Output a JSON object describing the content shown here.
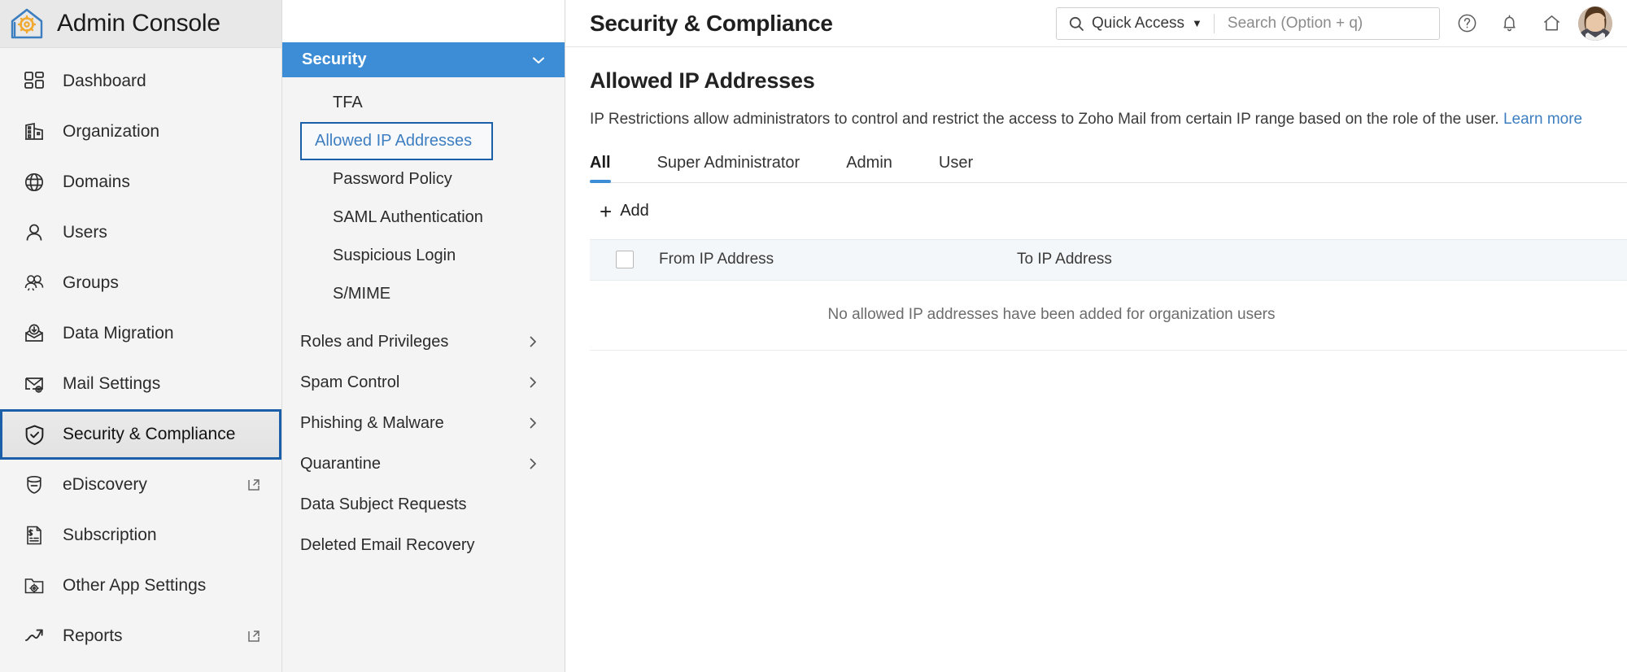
{
  "brand": {
    "title": "Admin Console",
    "logo_icon": "house-gear-logo"
  },
  "sidebar": {
    "items": [
      {
        "label": "Dashboard",
        "icon": "dashboard-grid-icon",
        "selected": false,
        "external": false
      },
      {
        "label": "Organization",
        "icon": "building-icon",
        "selected": false,
        "external": false
      },
      {
        "label": "Domains",
        "icon": "globe-icon",
        "selected": false,
        "external": false
      },
      {
        "label": "Users",
        "icon": "user-icon",
        "selected": false,
        "external": false
      },
      {
        "label": "Groups",
        "icon": "users-group-icon",
        "selected": false,
        "external": false
      },
      {
        "label": "Data Migration",
        "icon": "envelope-download-icon",
        "selected": false,
        "external": false
      },
      {
        "label": "Mail Settings",
        "icon": "envelope-gear-icon",
        "selected": false,
        "external": false
      },
      {
        "label": "Security & Compliance",
        "icon": "shield-check-icon",
        "selected": true,
        "external": false
      },
      {
        "label": "eDiscovery",
        "icon": "shield-search-icon",
        "selected": false,
        "external": true
      },
      {
        "label": "Subscription",
        "icon": "invoice-icon",
        "selected": false,
        "external": false
      },
      {
        "label": "Other App Settings",
        "icon": "folder-gear-icon",
        "selected": false,
        "external": false
      },
      {
        "label": "Reports",
        "icon": "trend-arrow-icon",
        "selected": false,
        "external": true
      }
    ]
  },
  "subpanel": {
    "header": {
      "title": "Security",
      "chevron_icon": "chevron-down-icon"
    },
    "items": [
      {
        "label": "TFA",
        "active": false
      },
      {
        "label": "Allowed IP Addresses",
        "active": true
      },
      {
        "label": "Password Policy",
        "active": false
      },
      {
        "label": "SAML Authentication",
        "active": false
      },
      {
        "label": "Suspicious Login",
        "active": false
      },
      {
        "label": "S/MIME",
        "active": false
      }
    ],
    "groups": [
      {
        "label": "Roles and Privileges",
        "chevron_icon": "chevron-right-icon"
      },
      {
        "label": "Spam Control",
        "chevron_icon": "chevron-right-icon"
      },
      {
        "label": "Phishing & Malware",
        "chevron_icon": "chevron-right-icon"
      },
      {
        "label": "Quarantine",
        "chevron_icon": "chevron-right-icon"
      },
      {
        "label": "Data Subject Requests",
        "chevron_icon": null
      },
      {
        "label": "Deleted Email Recovery",
        "chevron_icon": null
      }
    ]
  },
  "topbar": {
    "page_heading": "Security & Compliance",
    "quick_access_label": "Quick Access",
    "quick_access_caret": "▼",
    "search_placeholder": "Search (Option + q)",
    "search_value": "",
    "search_icon": "search-icon",
    "help_icon": "help-circle-icon",
    "notifications_icon": "bell-icon",
    "home_icon": "home-icon",
    "avatar_icon": "user-avatar"
  },
  "content": {
    "title": "Allowed IP Addresses",
    "description": "IP Restrictions allow administrators to control and restrict the access to Zoho Mail from certain IP range based on the role of the user.",
    "learn_more": "Learn more",
    "tabs": [
      {
        "label": "All",
        "active": true
      },
      {
        "label": "Super Administrator",
        "active": false
      },
      {
        "label": "Admin",
        "active": false
      },
      {
        "label": "User",
        "active": false
      }
    ],
    "add_button": {
      "label": "Add",
      "icon": "plus-icon"
    },
    "table": {
      "columns": [
        "From IP Address",
        "To IP Address"
      ],
      "rows": [],
      "empty_message": "No allowed IP addresses have been added for organization users"
    }
  },
  "colors": {
    "accent_blue": "#3d8dd6",
    "focus_blue": "#1b5fa8",
    "link_blue": "#3d7ec0",
    "sidebar_bg": "#f4f4f4",
    "brand_bg": "#e8e8e8",
    "table_header_bg": "#f4f7f9"
  }
}
